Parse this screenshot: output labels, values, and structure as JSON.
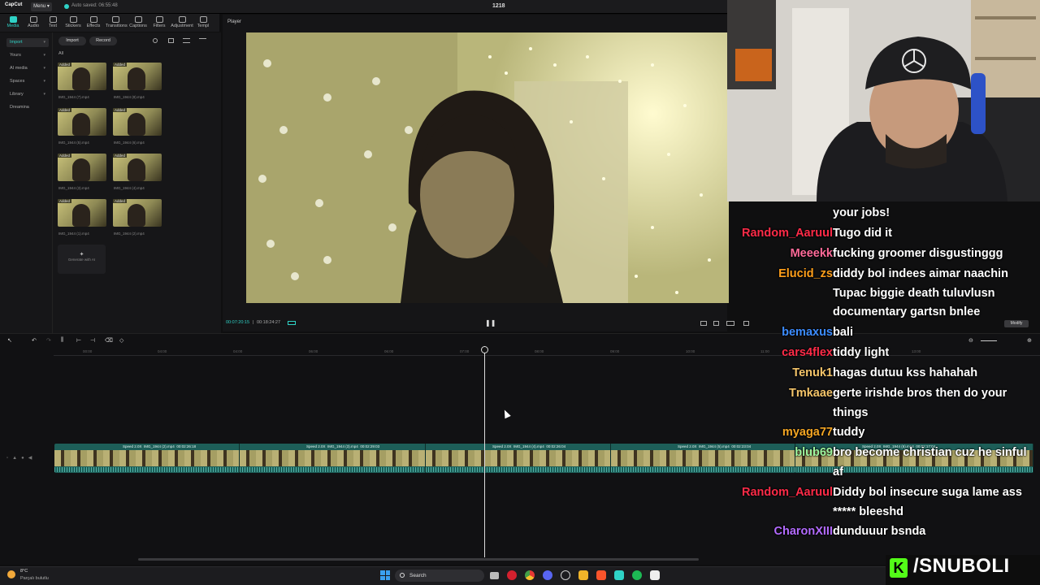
{
  "titlebar": {
    "logo": "CapCut",
    "menu": "Menu ▾",
    "autosave": "Auto saved: 06:55:48",
    "project_title": "1218"
  },
  "toolbar": {
    "tools": [
      "Media",
      "Audio",
      "Text",
      "Stickers",
      "Effects",
      "Transitions",
      "Captions",
      "Filters",
      "Adjustment",
      "Templ"
    ],
    "active": "Media"
  },
  "leftnav": {
    "items": [
      "Import",
      "Yours",
      "AI media",
      "Spaces",
      "Library",
      "Dreamina"
    ],
    "selected": "Import"
  },
  "media": {
    "import_label": "Import",
    "record_label": "Record",
    "all_label": "All",
    "added_badge": "Added",
    "files": [
      "IMG_1944 (7).mp4",
      "IMG_1944 (8).mp4",
      "IMG_1944 (5).mp4",
      "IMG_1944 (6).mp4",
      "IMG_1944 (3).mp4",
      "IMG_1944 (4).mp4",
      "IMG_1944 (1).mp4",
      "IMG_1944 (2).mp4"
    ],
    "generate_label": "Generate with AI"
  },
  "player": {
    "label": "Player",
    "time_current": "00:07:20:15",
    "time_total": "00:18:24:27",
    "modify_label": "Modify"
  },
  "timeline": {
    "ruler": [
      "00:00",
      "04:00",
      "04:00",
      "06:00",
      "06:00",
      "07:00",
      "08:00",
      "09:00",
      "10:00",
      "11:00",
      "12:00",
      "13:00"
    ],
    "clips": [
      {
        "speed": "Speed 2.0X",
        "name": "IMG_1944 (2).mp4",
        "dur": "00:02:26:18"
      },
      {
        "speed": "Speed 2.0X",
        "name": "IMG_1944 (3).mp4",
        "dur": "00:02:29:03"
      },
      {
        "speed": "Speed 2.0X",
        "name": "IMG_1944 (4).mp4",
        "dur": "00:02:26:04"
      },
      {
        "speed": "Speed 2.0X",
        "name": "IMG_1944 (5).mp4",
        "dur": "00:02:23:04"
      },
      {
        "speed": "Speed 2.0X",
        "name": "IMG_1944 (6).mp4",
        "dur": "00:02:17:04"
      }
    ]
  },
  "chat": {
    "messages": [
      {
        "user": "",
        "text": "your jobs!",
        "color": "#ffffff"
      },
      {
        "user": "Random_Aaruul",
        "text": "Tugo did it",
        "color": "#ff2b48"
      },
      {
        "user": "Meeekk",
        "text": "fucking groomer disgustinggg",
        "color": "#ff6b9a"
      },
      {
        "user": "Elucid_zs",
        "text": "diddy bol indees aimar naachin Tupac biggie death tuluvlusn documentary gartsn bnlee",
        "color": "#ff9f1a"
      },
      {
        "user": "bemaxus",
        "text": "bali",
        "color": "#3c8cff"
      },
      {
        "user": "cars4flex",
        "text": "tiddy light",
        "color": "#ff2b48"
      },
      {
        "user": "Tenuk1",
        "text": "hagas dutuu kss hahahah",
        "color": "#f5c56a"
      },
      {
        "user": "Tmkaae",
        "text": "gerte irishde bros then do your things",
        "color": "#f5c56a"
      },
      {
        "user": "myaga77",
        "text": "tuddy",
        "color": "#f5a623"
      },
      {
        "user": "blub69",
        "text": "bro become christian cuz he sinful af",
        "color": "#9ef59e"
      },
      {
        "user": "Random_Aaruul",
        "text": "Diddy bol insecure suga lame ass ***** bleeshd",
        "color": "#ff2b48"
      },
      {
        "user": "CharonXIII",
        "text": "dunduuur bsnda",
        "color": "#b36bff"
      }
    ]
  },
  "taskbar": {
    "weather_temp": "8°C",
    "weather_desc": "Parçalı bulutlu",
    "search": "Search"
  },
  "watermark": {
    "logo": "K",
    "text": "/SNUBOLI"
  }
}
